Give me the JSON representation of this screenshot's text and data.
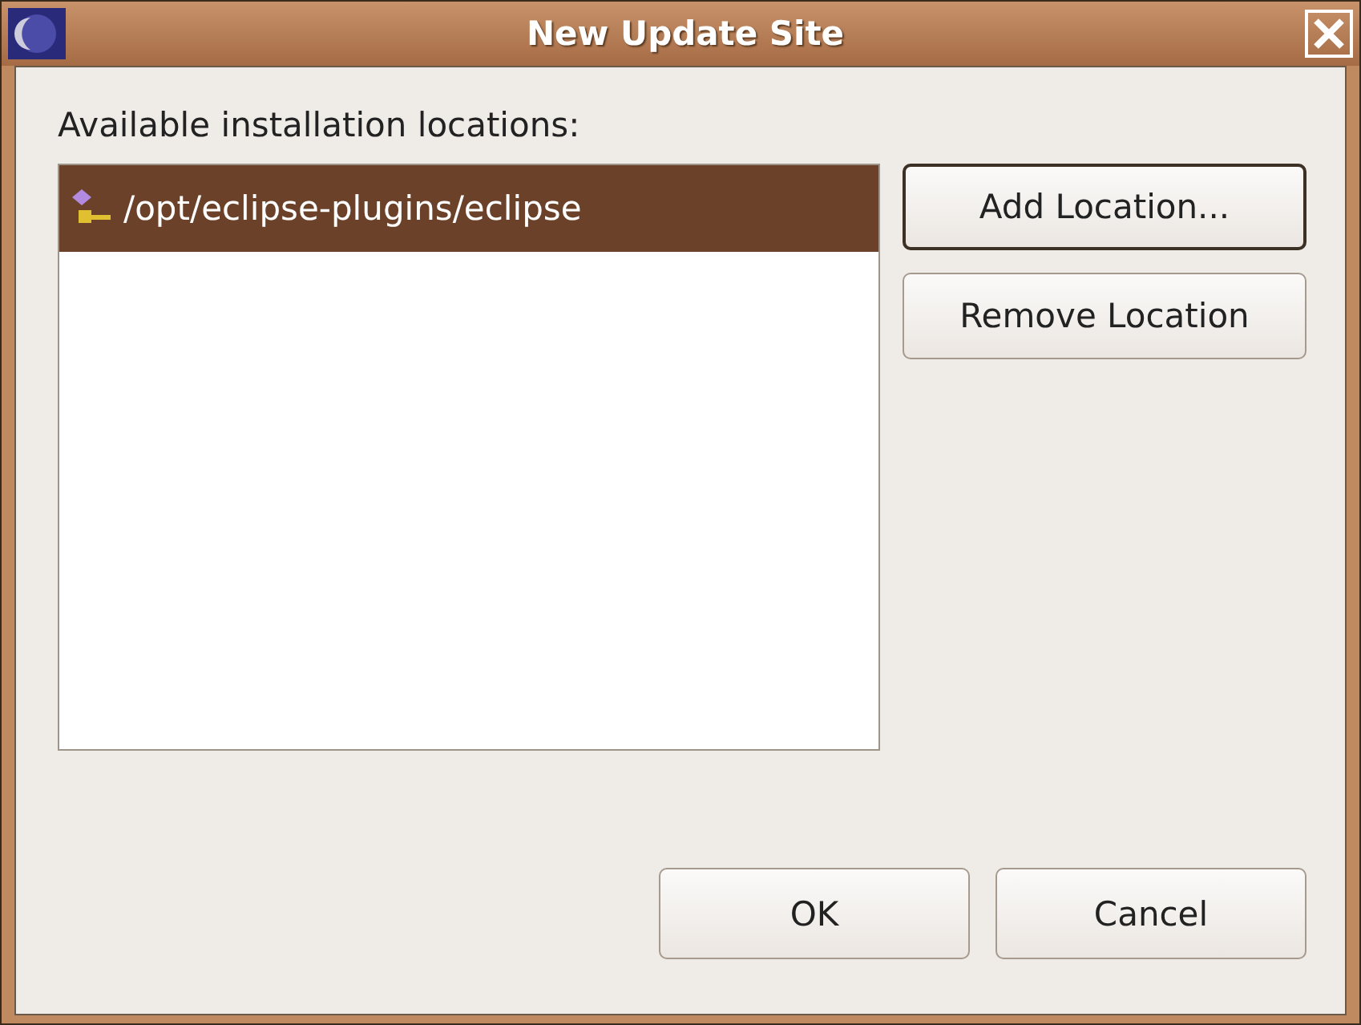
{
  "window": {
    "title": "New Update Site"
  },
  "label": "Available installation locations:",
  "locations": [
    {
      "path": "/opt/eclipse-plugins/eclipse",
      "selected": true
    }
  ],
  "side_buttons": [
    {
      "label": "Add Location...",
      "focused": true
    },
    {
      "label": "Remove Location",
      "focused": false
    }
  ],
  "buttons": [
    {
      "label": "OK"
    },
    {
      "label": "Cancel"
    }
  ]
}
